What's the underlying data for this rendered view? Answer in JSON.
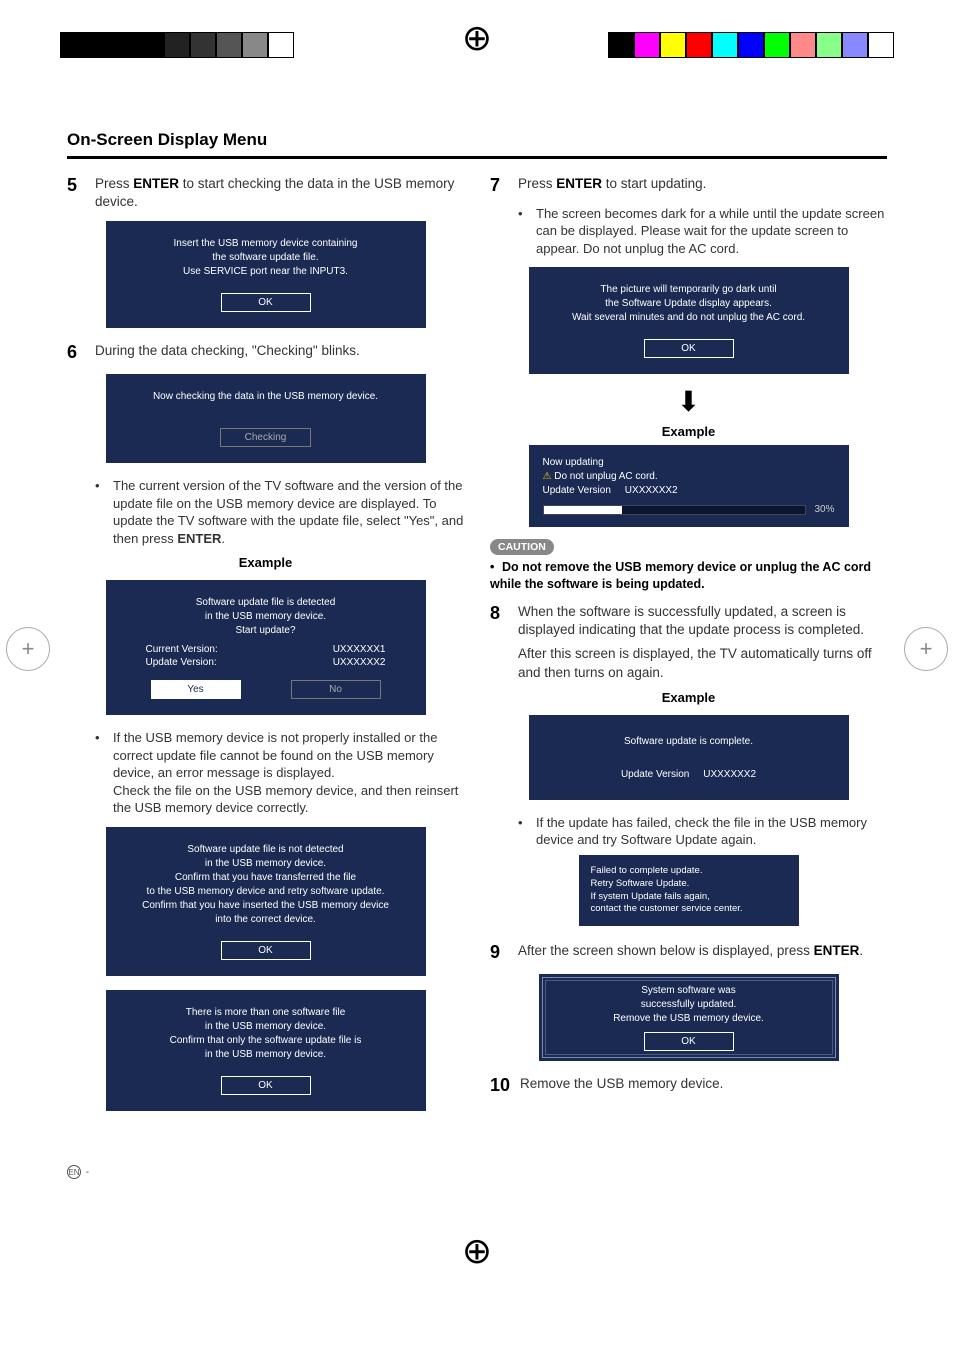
{
  "title": "On-Screen Display Menu",
  "left": {
    "step5": {
      "num": "5",
      "pre": "Press ",
      "bold": "ENTER",
      "post": " to start checking the data in the USB memory device."
    },
    "dlg5": {
      "line1": "Insert the USB memory device containing",
      "line2": "the software update file.",
      "line3": "Use SERVICE port near the INPUT3.",
      "ok": "OK"
    },
    "step6": {
      "num": "6",
      "text": "During the data checking, \"Checking\" blinks."
    },
    "dlg6": {
      "line1": "Now checking the data in the USB memory device.",
      "btn": "Checking"
    },
    "bullet6": "The current version of the TV software and the version of the update file on the USB memory device are displayed. To update the TV software with the update file, select \"Yes\", and then press ",
    "bullet6bold": "ENTER",
    "bullet6dot": ".",
    "exLabel1": "Example",
    "dlgUpd": {
      "line1": "Software update file is detected",
      "line2": "in the USB memory device.",
      "line3": "Start update?",
      "cv_label": "Current Version:",
      "cv_val": "UXXXXXX1",
      "uv_label": "Update Version:",
      "uv_val": "UXXXXXX2",
      "yes": "Yes",
      "no": "No"
    },
    "bulletErr": "If the USB memory device is not properly installed or the correct update file cannot be found on the USB memory device, an error message is displayed.",
    "bulletErr2": "Check the file on the USB memory device, and then reinsert the USB memory device correctly.",
    "dlgNotDetected": {
      "l1": "Software update file is not detected",
      "l2": "in the USB memory device.",
      "l3": "Confirm that you have transferred the file",
      "l4": "to the USB memory device and retry software update.",
      "l5": "Confirm that you have inserted the USB memory device",
      "l6": "into the correct device.",
      "ok": "OK"
    },
    "dlgMulti": {
      "l1": "There is more than one software file",
      "l2": "in the USB memory device.",
      "l3": "Confirm that only the software update file is",
      "l4": "in the USB memory device.",
      "ok": "OK"
    }
  },
  "right": {
    "step7": {
      "num": "7",
      "pre": "Press ",
      "bold": "ENTER",
      "post": " to start updating."
    },
    "bullet7": "The screen becomes dark for a while until the update screen can be displayed. Please wait for the update screen to appear. Do not unplug the AC cord.",
    "dlg7": {
      "l1": "The picture will temporarily go dark until",
      "l2": "the Software Update display appears.",
      "l3": "Wait several minutes and do not unplug the AC cord.",
      "ok": "OK"
    },
    "exLabel2": "Example",
    "progress": {
      "l1": "Now updating",
      "l2": "Do not unplug AC cord.",
      "uv_label": "Update Version",
      "uv_val": "UXXXXXX2",
      "pct": "30%"
    },
    "cautionBadge": "CAUTION",
    "cautionText": "Do not remove the USB memory device or unplug the AC cord while the software is being updated.",
    "step8": {
      "num": "8",
      "text1": "When the software is successfully updated, a screen is displayed indicating that the update process is completed.",
      "text2": "After this screen is displayed, the TV automatically turns off and then turns on again."
    },
    "exLabel3": "Example",
    "dlgComplete": {
      "l1": "Software update is complete.",
      "uv_label": "Update Version",
      "uv_val": "UXXXXXX2"
    },
    "bulletFail": "If the update has failed, check the file in the USB memory device and try Software Update again.",
    "dlgFail": {
      "l1": "Failed to complete update.",
      "l2": "Retry Software Update.",
      "l3": "If system Update fails again,",
      "l4": "contact the customer service center."
    },
    "step9": {
      "num": "9",
      "pre": "After the screen shown below is displayed, press ",
      "bold": "ENTER",
      "post": "."
    },
    "dlg9": {
      "l1": "System software was",
      "l2": "successfully updated.",
      "l3": "Remove the USB memory device.",
      "ok": "OK"
    },
    "step10": {
      "num": "10",
      "text": "Remove the USB memory device."
    }
  },
  "footer": {
    "lang": "EN",
    "hyphen": " -"
  }
}
